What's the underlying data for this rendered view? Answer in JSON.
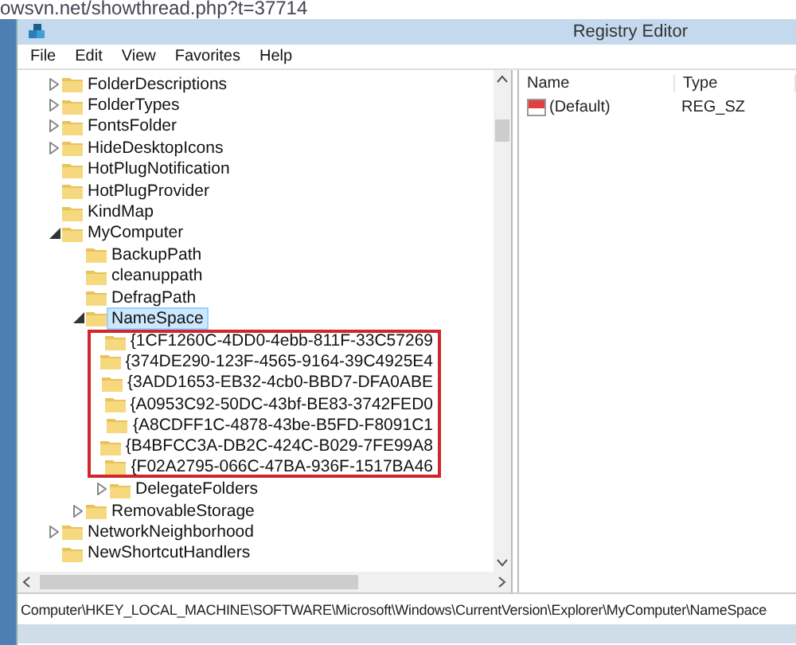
{
  "browser_url": "owsvn.net/showthread.php?t=37714",
  "window": {
    "title": "Registry Editor"
  },
  "menu": [
    "File",
    "Edit",
    "View",
    "Favorites",
    "Help"
  ],
  "tree": [
    {
      "label": "FolderDescriptions",
      "expanded": false
    },
    {
      "label": "FolderTypes",
      "expanded": false
    },
    {
      "label": "FontsFolder",
      "expanded": false
    },
    {
      "label": "HideDesktopIcons",
      "expanded": false
    },
    {
      "label": "HotPlugNotification"
    },
    {
      "label": "HotPlugProvider"
    },
    {
      "label": "KindMap"
    },
    {
      "label": "MyComputer",
      "expanded": true,
      "children": [
        {
          "label": "BackupPath"
        },
        {
          "label": "cleanuppath"
        },
        {
          "label": "DefragPath"
        },
        {
          "label": "NameSpace",
          "expanded": true,
          "selected": true,
          "children": [
            {
              "label": "{1CF1260C-4DD0-4ebb-811F-33C57269",
              "highlighted": true
            },
            {
              "label": "{374DE290-123F-4565-9164-39C4925E4",
              "highlighted": true
            },
            {
              "label": "{3ADD1653-EB32-4cb0-BBD7-DFA0ABE",
              "highlighted": true
            },
            {
              "label": "{A0953C92-50DC-43bf-BE83-3742FED0",
              "highlighted": true
            },
            {
              "label": "{A8CDFF1C-4878-43be-B5FD-F8091C1",
              "highlighted": true
            },
            {
              "label": "{B4BFCC3A-DB2C-424C-B029-7FE99A8",
              "highlighted": true
            },
            {
              "label": "{F02A2795-066C-47BA-936F-1517BA46",
              "highlighted": true
            },
            {
              "label": "DelegateFolders",
              "expanded": false,
              "highlighted": false
            }
          ]
        },
        {
          "label": "RemovableStorage",
          "expanded": false
        }
      ]
    },
    {
      "label": "NetworkNeighborhood",
      "expanded": false
    },
    {
      "label": "NewShortcutHandlers"
    }
  ],
  "values_table": {
    "columns": [
      "Name",
      "Type"
    ],
    "rows": [
      {
        "name": "(Default)",
        "type": "REG_SZ"
      }
    ]
  },
  "status_bar": "Computer\\HKEY_LOCAL_MACHINE\\SOFTWARE\\Microsoft\\Windows\\CurrentVersion\\Explorer\\MyComputer\\NameSpace"
}
